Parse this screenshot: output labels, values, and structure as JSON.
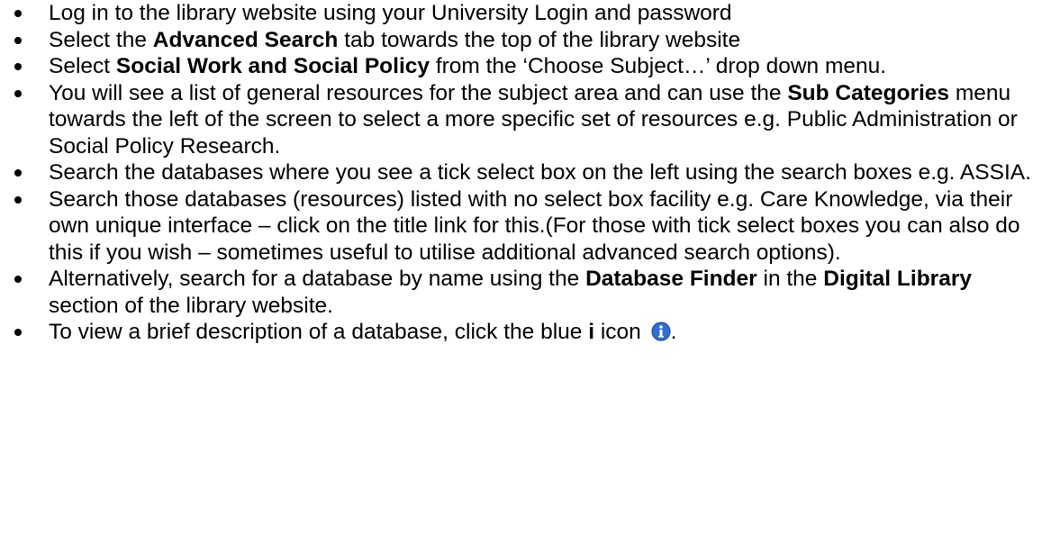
{
  "instructions": [
    {
      "parts": [
        {
          "t": "Log in to the library website using your University Login and password"
        }
      ]
    },
    {
      "parts": [
        {
          "t": "Select the "
        },
        {
          "t": "Advanced Search",
          "b": true
        },
        {
          "t": " tab towards the top of the library website"
        }
      ]
    },
    {
      "parts": [
        {
          "t": "Select "
        },
        {
          "t": "Social Work and Social Policy",
          "b": true
        },
        {
          "t": " from the ‘Choose Subject…’ drop down menu."
        }
      ]
    },
    {
      "parts": [
        {
          "t": "You will see a list of general resources for the subject area and can use the "
        },
        {
          "t": "Sub Categories",
          "b": true
        },
        {
          "t": " menu towards the left of the screen to select a more specific set of resources e.g. Public Administration or Social Policy Research."
        }
      ]
    },
    {
      "parts": [
        {
          "t": "Search the databases where you see a tick select box on the left using the search boxes e.g. ASSIA."
        }
      ]
    },
    {
      "parts": [
        {
          "t": "Search those databases (resources) listed with no select box facility e.g. Care Knowledge, via their own unique interface – click on the title link for this.(For those with tick select boxes you can also do this if you wish – sometimes useful to utilise additional advanced search options)."
        }
      ]
    },
    {
      "parts": [
        {
          "t": "Alternatively, search for a database by name using the "
        },
        {
          "t": "Database Finder",
          "b": true
        },
        {
          "t": " in the "
        },
        {
          "t": "Digital Library",
          "b": true
        },
        {
          "t": " section of the library website."
        }
      ]
    },
    {
      "parts": [
        {
          "t": "To view a brief description of a database, click the blue "
        },
        {
          "t": "i",
          "b": true
        },
        {
          "t": " icon "
        },
        {
          "icon": "info-icon"
        },
        {
          "t": "."
        }
      ]
    }
  ],
  "colors": {
    "text": "#000000",
    "info_icon_fill": "#2f6fd0",
    "info_icon_ring": "#1d4f9e"
  }
}
